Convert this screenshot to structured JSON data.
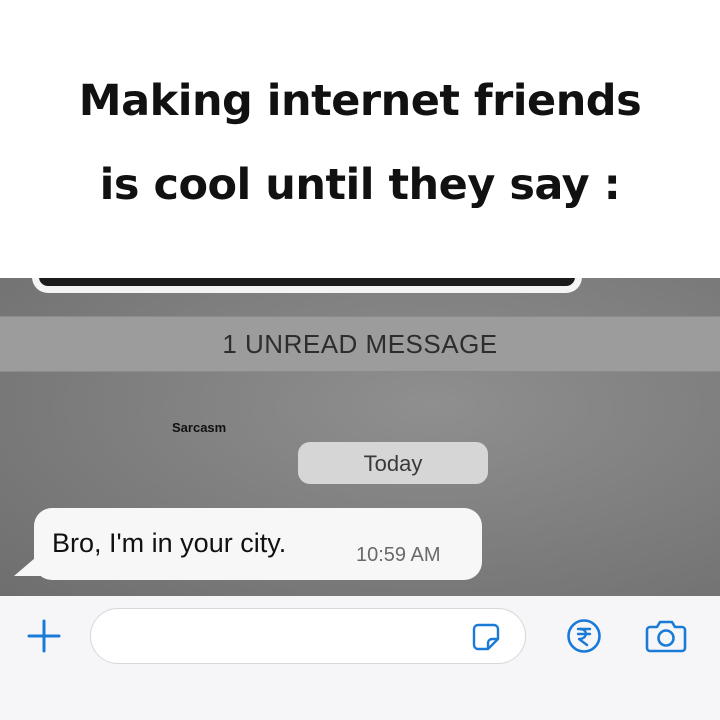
{
  "caption": {
    "line1": "Making internet friends",
    "line2": "is cool until they say :"
  },
  "chat": {
    "unread_banner": "1 UNREAD MESSAGE",
    "watermark": "Sarcasm",
    "date_label": "Today",
    "message": {
      "text": "Bro, I'm in your city.",
      "time": "10:59 AM"
    }
  },
  "input_bar": {
    "icons": [
      "plus-icon",
      "sticker-icon",
      "rupee-payment-icon",
      "camera-icon"
    ],
    "accent_color": "#1a7bd6"
  }
}
